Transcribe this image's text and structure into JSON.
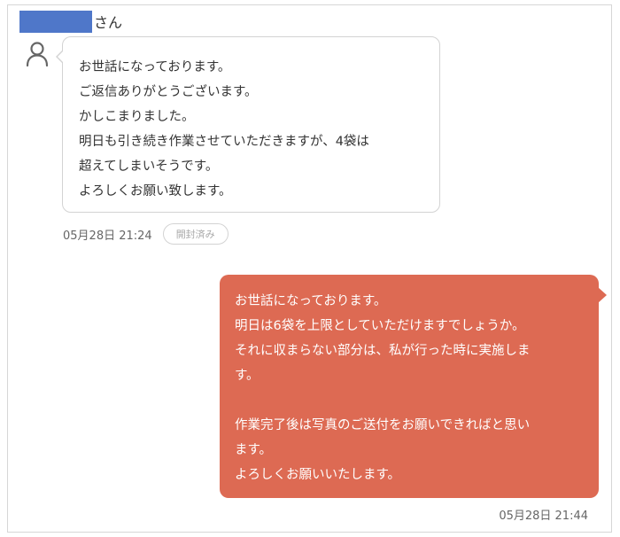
{
  "sender": {
    "suffix": "さん"
  },
  "incoming": {
    "text": "お世話になっております。\nご返信ありがとうございます。\nかしこまりました。\n明日も引き続き作業させていただきますが、4袋は\n超えてしまいそうです。\nよろしくお願い致します。",
    "time": "05月28日 21:24",
    "badge": "開封済み"
  },
  "outgoing": {
    "text": "お世話になっております。\n明日は6袋を上限としていただけますでしょうか。\nそれに収まらない部分は、私が行った時に実施しま\nす。\n\n作業完了後は写真のご送付をお願いできればと思い\nます。\nよろしくお願いいたします。",
    "time": "05月28日 21:44"
  },
  "colors": {
    "accent": "#dd6a53",
    "redaction": "#4f77c9"
  },
  "icons": {
    "avatar": "person-icon"
  }
}
